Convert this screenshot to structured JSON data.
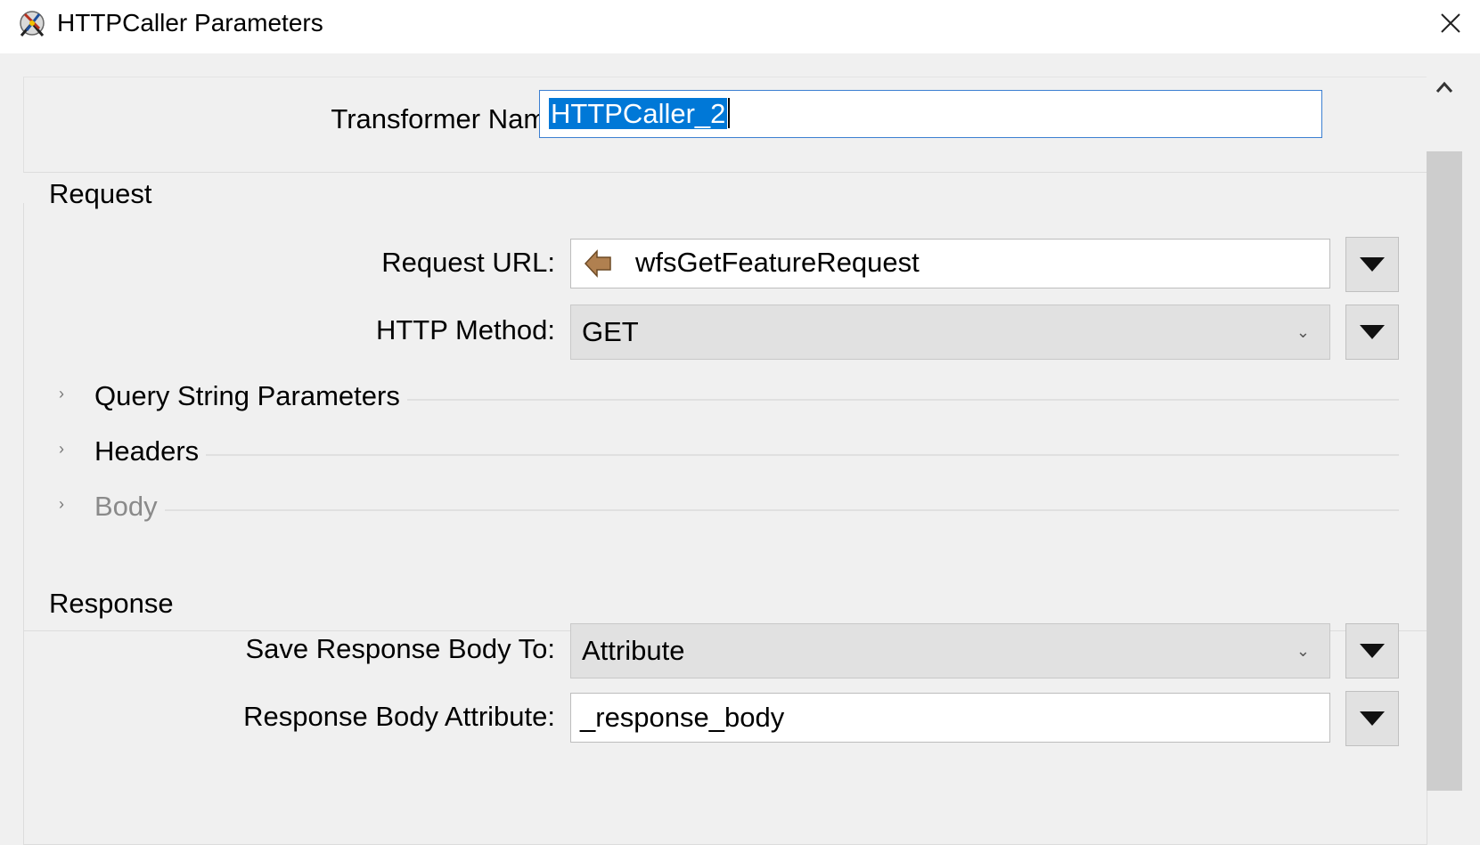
{
  "window": {
    "title": "HTTPCaller Parameters",
    "app_icon": "fme-transformer-icon",
    "close_icon": "close-icon"
  },
  "transformer": {
    "label": "Transformer Name:",
    "value": "HTTPCaller_2"
  },
  "request": {
    "title": "Request",
    "url_label": "Request URL:",
    "url_value": "wfsGetFeatureRequest",
    "url_icon": "attribute-arrow-icon",
    "method_label": "HTTP Method:",
    "method_value": "GET",
    "sections": [
      {
        "label": "Query String Parameters",
        "enabled": true
      },
      {
        "label": "Headers",
        "enabled": true
      },
      {
        "label": "Body",
        "enabled": false
      }
    ]
  },
  "response": {
    "title": "Response",
    "save_to_label": "Save Response Body To:",
    "save_to_value": "Attribute",
    "body_attr_label": "Response Body Attribute:",
    "body_attr_value": "_response_body"
  },
  "colors": {
    "selection": "#0078d7",
    "focus_border": "#3c7fd1",
    "panel_bg": "#f0f0f0",
    "combo_bg": "#e1e1e1"
  }
}
